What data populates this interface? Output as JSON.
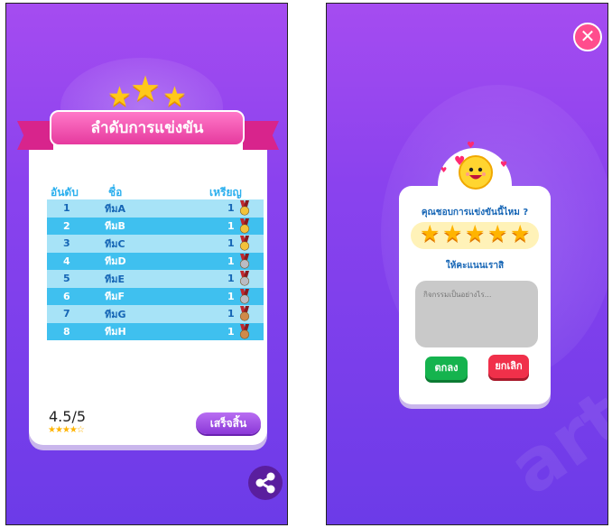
{
  "left_panel": {
    "title": "ลำดับการแข่งขัน",
    "columns": {
      "rank": "อันดับ",
      "name": "ชื่อ",
      "medal": "เหรียญ"
    },
    "rows": [
      {
        "rank": "1",
        "team": "ทีมA",
        "medals": "1",
        "medal_type": "gold"
      },
      {
        "rank": "2",
        "team": "ทีมB",
        "medals": "1",
        "medal_type": "gold"
      },
      {
        "rank": "3",
        "team": "ทีมC",
        "medals": "1",
        "medal_type": "gold"
      },
      {
        "rank": "4",
        "team": "ทีมD",
        "medals": "1",
        "medal_type": "silver"
      },
      {
        "rank": "5",
        "team": "ทีมE",
        "medals": "1",
        "medal_type": "silver"
      },
      {
        "rank": "6",
        "team": "ทีมF",
        "medals": "1",
        "medal_type": "silver"
      },
      {
        "rank": "7",
        "team": "ทีมG",
        "medals": "1",
        "medal_type": "bronze"
      },
      {
        "rank": "8",
        "team": "ทีมH",
        "medals": "1",
        "medal_type": "bronze"
      }
    ],
    "score": "4.5/5",
    "score_rating": 4.5,
    "done_label": "เสร็จสิ้น",
    "icons": {
      "share": "share-icon",
      "stars": "star-icon"
    }
  },
  "right_panel": {
    "question": "คุณชอบการแข่งขันนี้ไหม ?",
    "rating_stars": 5,
    "rate_label": "ให้คะแนนเราสิ",
    "comment_placeholder": "กิจกรรมเป็นอย่างไร...",
    "ok_label": "ตกลง",
    "cancel_label": "ยกเลิก",
    "close_label": "✕",
    "icons": {
      "close": "close-icon",
      "face": "smiley-face-icon",
      "hearts": "heart-icon"
    }
  },
  "colors": {
    "background_purple": "#8a42ee",
    "ribbon_pink": "#e63a9e",
    "table_light": "#a7e3f7",
    "table_dark": "#3fc0ef",
    "ok_green": "#15b34e",
    "cancel_red": "#f0304a",
    "gold": "#f2c23a",
    "silver": "#b9bcc4",
    "bronze": "#d08a4a"
  }
}
